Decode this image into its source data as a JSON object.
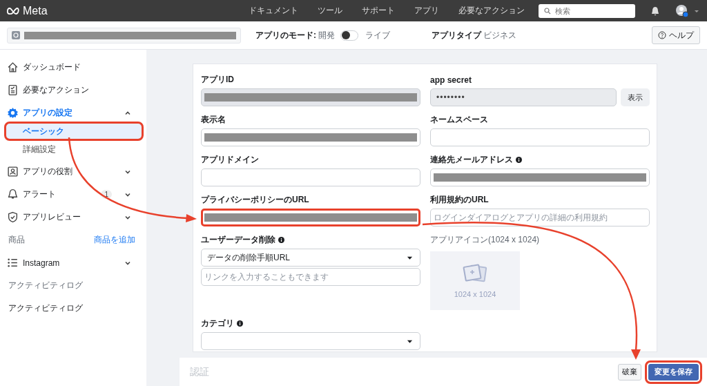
{
  "top_bar": {
    "logo": "Meta",
    "nav": [
      "ドキュメント",
      "ツール",
      "サポート",
      "アプリ",
      "必要なアクション"
    ],
    "search": {
      "placeholder": "検索"
    }
  },
  "app_bar": {
    "app_name_redacted": true,
    "mode_label": "アプリのモード:",
    "mode_value": "開発",
    "live": false,
    "live_label": "ライブ",
    "type_label": "アプリタイプ",
    "type_value": "ビジネス",
    "help": "ヘルプ"
  },
  "sidebar": {
    "items": [
      {
        "kind": "nav",
        "label": "ダッシュボード"
      },
      {
        "kind": "nav",
        "label": "必要なアクション"
      },
      {
        "kind": "nav",
        "label": "アプリの設定",
        "expanded": true,
        "children": [
          {
            "label": "ベーシック",
            "selected": true,
            "highlighted": true
          },
          {
            "label": "詳細設定",
            "selected": false,
            "highlighted": false
          }
        ]
      },
      {
        "kind": "nav",
        "label": "アプリの役割",
        "expanded": false
      },
      {
        "kind": "nav",
        "label": "アラート",
        "badge": "1",
        "expanded": false
      },
      {
        "kind": "nav",
        "label": "アプリレビュー",
        "expanded": false
      },
      {
        "kind": "section",
        "label": "商品",
        "action": "商品を追加"
      },
      {
        "kind": "nav",
        "label": "Instagram",
        "expanded": false
      },
      {
        "kind": "section",
        "label": "アクティビティログ"
      },
      {
        "kind": "nav",
        "label": "アクティビティログ"
      }
    ]
  },
  "form": {
    "fields": [
      {
        "kind": "text",
        "label": "アプリID",
        "readonly": true,
        "redacted": true,
        "highlighted": false
      },
      {
        "kind": "secret",
        "label": "app secret",
        "value": "••••••••",
        "button": "表示"
      },
      {
        "kind": "text",
        "label": "表示名",
        "readonly": false,
        "redacted": true,
        "highlighted": false
      },
      {
        "kind": "text",
        "label": "ネームスペース",
        "readonly": false,
        "redacted": false,
        "highlighted": false
      },
      {
        "kind": "text",
        "label": "アプリドメイン",
        "readonly": false,
        "redacted": false,
        "highlighted": false
      },
      {
        "kind": "text",
        "label": "連絡先メールアドレス",
        "info": true,
        "readonly": false,
        "redacted": true,
        "highlighted": false
      },
      {
        "kind": "text",
        "label": "プライバシーポリシーのURL",
        "readonly": false,
        "redacted": true,
        "highlighted": true
      },
      {
        "kind": "text",
        "label": "利用規約のURL",
        "readonly": false,
        "redacted": false,
        "highlighted": false,
        "placeholder": "ログインダイアログとアプリの詳細の利用規約"
      },
      {
        "kind": "select",
        "label": "ユーザーデータ削除",
        "info": true,
        "value": "データの削除手順URL",
        "placeholder": "リンクを入力することもできます"
      },
      {
        "kind": "image",
        "label": "アプリアイコン(1024 x 1024)",
        "caption": "1024 x 1024"
      },
      {
        "kind": "select",
        "label": "カテゴリ",
        "info": true
      }
    ]
  },
  "footer": {
    "title": "認証",
    "buttons": [
      {
        "label": "破棄",
        "kind": "secondary",
        "highlighted": false
      },
      {
        "label": "変更を保存",
        "kind": "primary",
        "highlighted": true
      }
    ]
  }
}
